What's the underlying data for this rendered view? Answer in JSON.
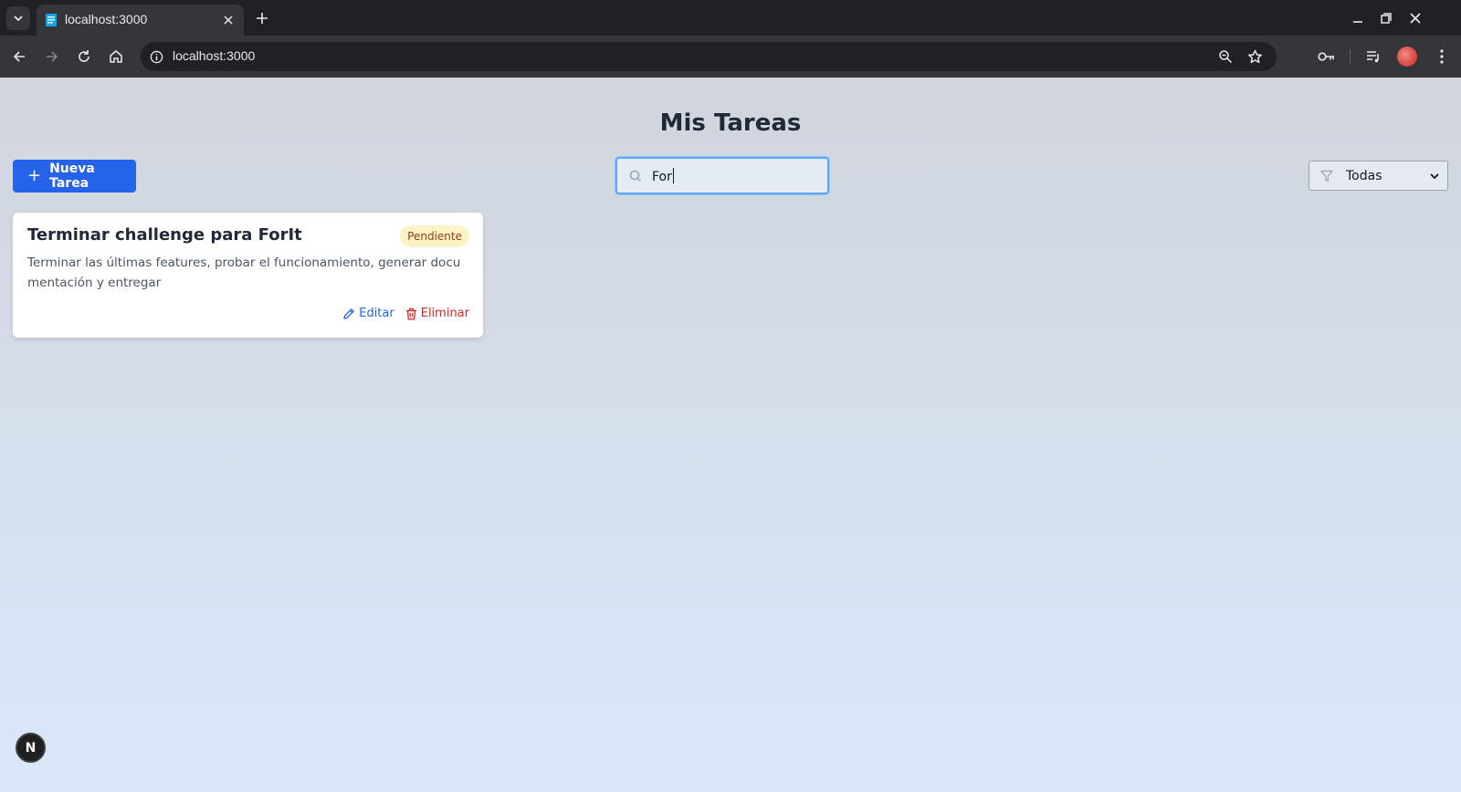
{
  "browser": {
    "tab_title": "localhost:3000",
    "url": "localhost:3000",
    "icons": [
      "tab-list-icon",
      "close-icon",
      "plus-icon",
      "minimize-icon",
      "restore-icon",
      "close-icon",
      "back-icon",
      "forward-icon",
      "reload-icon",
      "home-icon",
      "info-icon",
      "zoom-icon",
      "star-icon",
      "password-key-icon",
      "media-queue-icon",
      "avatar",
      "menu-icon"
    ]
  },
  "app": {
    "title": "Mis Tareas",
    "new_task_label": "Nueva Tarea",
    "search": {
      "value": "For",
      "icon": "search-icon"
    },
    "filter": {
      "selected": "Todas",
      "icon": "filter-icon"
    },
    "tasks": [
      {
        "title": "Terminar challenge para ForIt",
        "status": "Pendiente",
        "description": "Terminar las últimas features, probar el funcionamiento, generar documentación y entregar",
        "edit_label": "Editar",
        "delete_label": "Eliminar"
      }
    ],
    "dev_badge": "N",
    "colors": {
      "primary": "#2563eb",
      "danger": "#dc2626",
      "pending_bg": "#fef3c7",
      "pending_text": "#92400e"
    }
  }
}
